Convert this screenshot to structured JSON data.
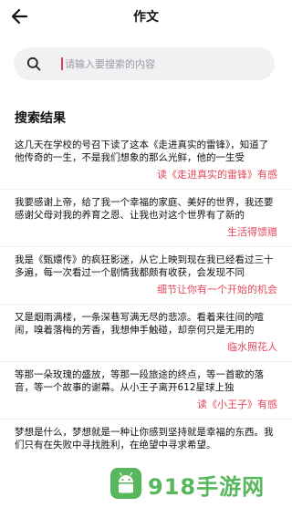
{
  "header": {
    "back_icon": "arrow-left-icon",
    "title": "作文"
  },
  "search": {
    "icon": "search-icon",
    "placeholder": "请输入要搜索的内容"
  },
  "section_title": "搜索结果",
  "results": [
    {
      "excerpt": "这几天在学校的号召下读了这本《走进真实的雷锋》，知道了他传奇的一生，不是我们想象的那么光鲜，他的一生受",
      "title": "读《走进真实的雷锋》有感"
    },
    {
      "excerpt": "我要感谢上帝，给了我一个幸福的家庭、美好的世界，我还要感谢父母对我的养育之恩、让我也对这个世界有了新的",
      "title": "生活得馈赠"
    },
    {
      "excerpt": "我是《甄嬛传》的疯狂影迷，从它上映到现在我已经看过三十多遍，每一次看过一个剧情我都颇有收获，会发现不同",
      "title": "细节让你有一个开始的机会"
    },
    {
      "excerpt": "又是烟雨满楼，一条深巷写满无尽的悲凉。看着来往间的喧闹，嗅着落梅的芳香，我想伸手触碰，却奈何只是无用的",
      "title": "临水照花人"
    },
    {
      "excerpt": "等那一朵玫瑰的盛放，等那一段旅途的终点，等一首歌的落音，等一个故事的谢幕。从小王子离开612星球上独",
      "title": "读《小王子》有感"
    },
    {
      "excerpt": "梦想是什么，梦想就是一种让你感到坚持就是幸福的东西。我们只有在失败中寻找胜利，在绝望中寻求希望。",
      "title": ""
    }
  ],
  "watermark": {
    "text": "918手游网",
    "logo_icon": "android-logo-icon",
    "color": "#3aaa41"
  },
  "colors": {
    "accent": "#e24a5a",
    "search_bg": "#f1f1f4"
  }
}
